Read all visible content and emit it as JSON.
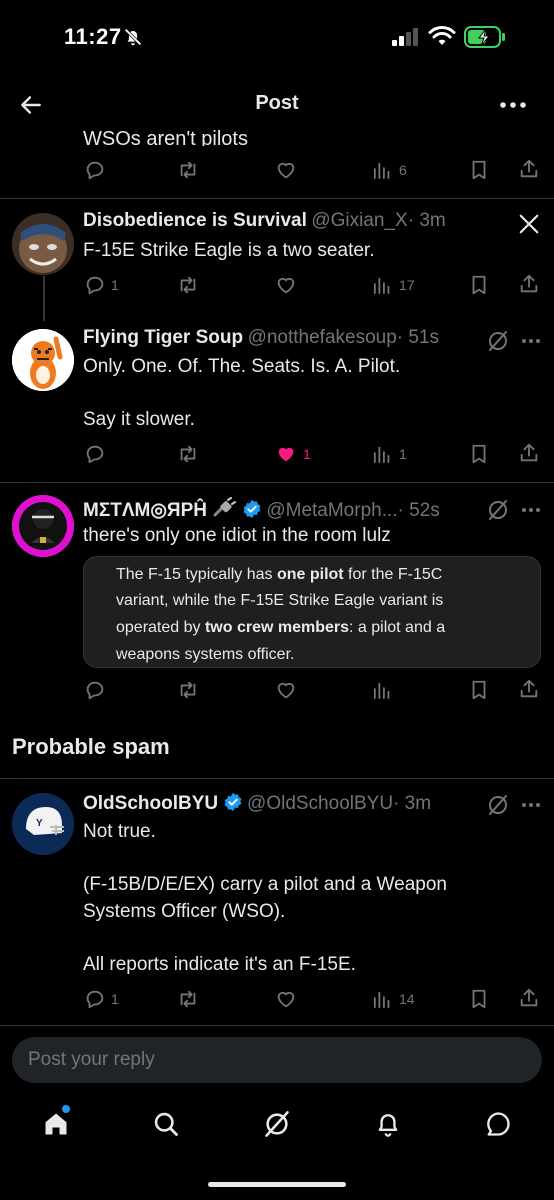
{
  "status_bar": {
    "time": "11:27"
  },
  "header": {
    "title": "Post"
  },
  "posts": [
    {
      "partial_text": "WSOs aren't pilots",
      "views": "6"
    },
    {
      "name": "Disobedience is Survival",
      "handle": "@Gixian_X",
      "time": "· 3m",
      "text": "F-15E Strike Eagle is a two seater.",
      "replies": "1",
      "views": "17"
    },
    {
      "name": "Flying Tiger Soup",
      "handle": "@notthefakesoup",
      "time": "· 51s",
      "text": "Only. One. Of. The. Seats. Is. A. Pilot.",
      "text2": "Say it slower.",
      "likes": "1",
      "views": "1"
    },
    {
      "name": "MΣTΛM◎ЯPĤ",
      "handle": "@MetaMorph...",
      "time": "· 52s",
      "text": "there's only one idiot in the room lulz",
      "quote": {
        "l1a": "The F-15 typically has ",
        "l1b": "one pilot",
        "l1c": " for the F-15C",
        "l2": "variant, while the F-15E Strike Eagle variant is",
        "l3a": "operated by ",
        "l3b": "two crew members",
        "l3c": ": a pilot and a",
        "l4": "weapons systems officer."
      }
    },
    {
      "name": "OldSchoolBYU",
      "handle": "@OldSchoolBYU",
      "time": "· 3m",
      "text": "Not true.",
      "text2": "(F-15B/D/E/EX) carry a pilot and a Weapon",
      "text3": "Systems Officer (WSO).",
      "text4": "All reports indicate it's an F-15E.",
      "replies": "1",
      "views": "14"
    }
  ],
  "section": {
    "probable_spam": "Probable spam"
  },
  "reply": {
    "placeholder": "Post your reply"
  },
  "colors": {
    "like_active": "#f91880",
    "verified": "#1d9bf0",
    "accent": "#1d9bf0"
  }
}
